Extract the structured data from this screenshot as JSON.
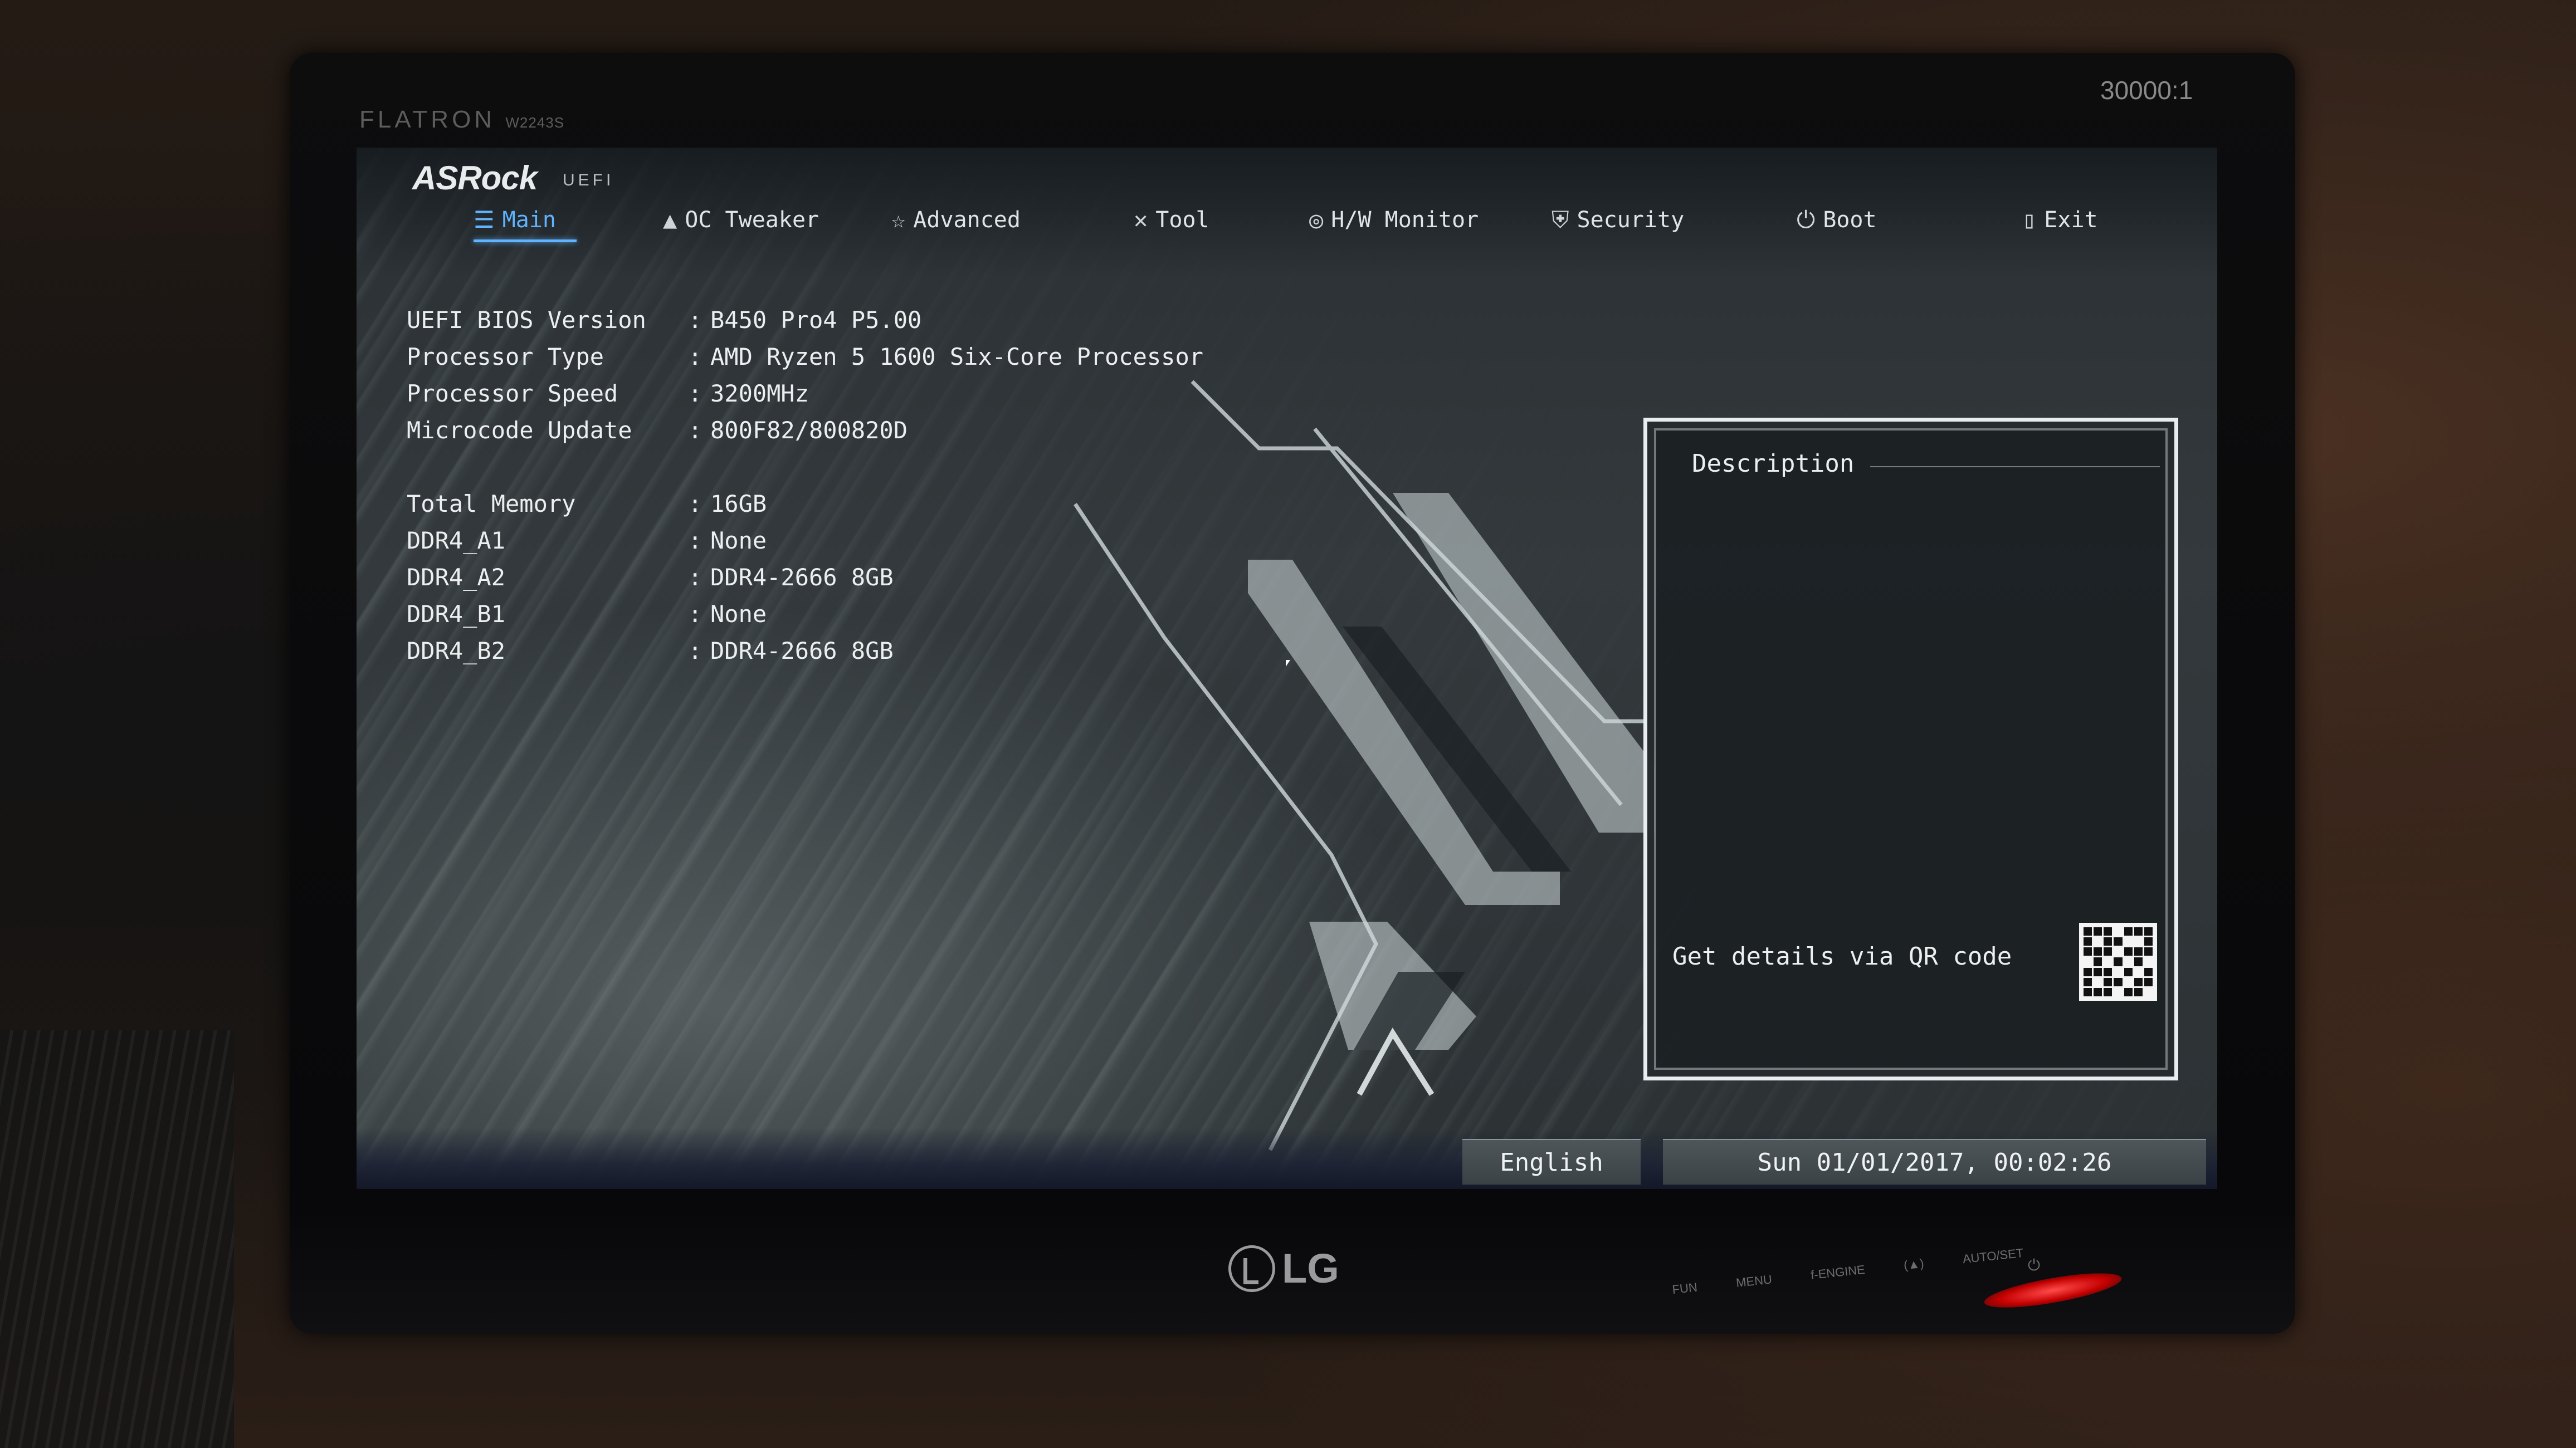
{
  "monitor": {
    "brand": "FLATRON",
    "model": "W2243S",
    "contrast": "30000:1",
    "logo": "LG",
    "buttons": [
      "FUN",
      "MENU",
      "f-ENGINE",
      "(▲)",
      "AUTO/SET"
    ]
  },
  "bios": {
    "logo": "ASRock",
    "logo_sub": "UEFI",
    "tabs": [
      {
        "label": "Main",
        "icon": "list-icon",
        "active": true
      },
      {
        "label": "OC Tweaker",
        "icon": "rocket-icon",
        "active": false
      },
      {
        "label": "Advanced",
        "icon": "star-icon",
        "active": false
      },
      {
        "label": "Tool",
        "icon": "tools-icon",
        "active": false
      },
      {
        "label": "H/W Monitor",
        "icon": "monitor-icon",
        "active": false
      },
      {
        "label": "Security",
        "icon": "shield-icon",
        "active": false
      },
      {
        "label": "Boot",
        "icon": "power-icon",
        "active": false
      },
      {
        "label": "Exit",
        "icon": "exit-icon",
        "active": false
      }
    ],
    "info": [
      {
        "label": "UEFI BIOS Version",
        "value": "B450 Pro4 P5.00"
      },
      {
        "label": "Processor Type",
        "value": "AMD Ryzen 5 1600 Six-Core Processor"
      },
      {
        "label": "Processor Speed",
        "value": "3200MHz"
      },
      {
        "label": "Microcode Update",
        "value": "800F82/800820D"
      },
      {
        "label": "Total Memory",
        "value": "16GB"
      },
      {
        "label": "DDR4_A1",
        "value": "None"
      },
      {
        "label": "DDR4_A2",
        "value": "DDR4-2666 8GB"
      },
      {
        "label": "DDR4_B1",
        "value": "None"
      },
      {
        "label": "DDR4_B2",
        "value": "DDR4-2666 8GB"
      }
    ],
    "colon": ":",
    "description": {
      "title": "Description",
      "qr_label": "Get details via QR code"
    },
    "language": "English",
    "datetime": "Sun 01/01/2017, 00:02:26"
  },
  "colors": {
    "accent": "#5fb3ff",
    "text": "#ecefef",
    "panel_border": "#e8eef0"
  }
}
